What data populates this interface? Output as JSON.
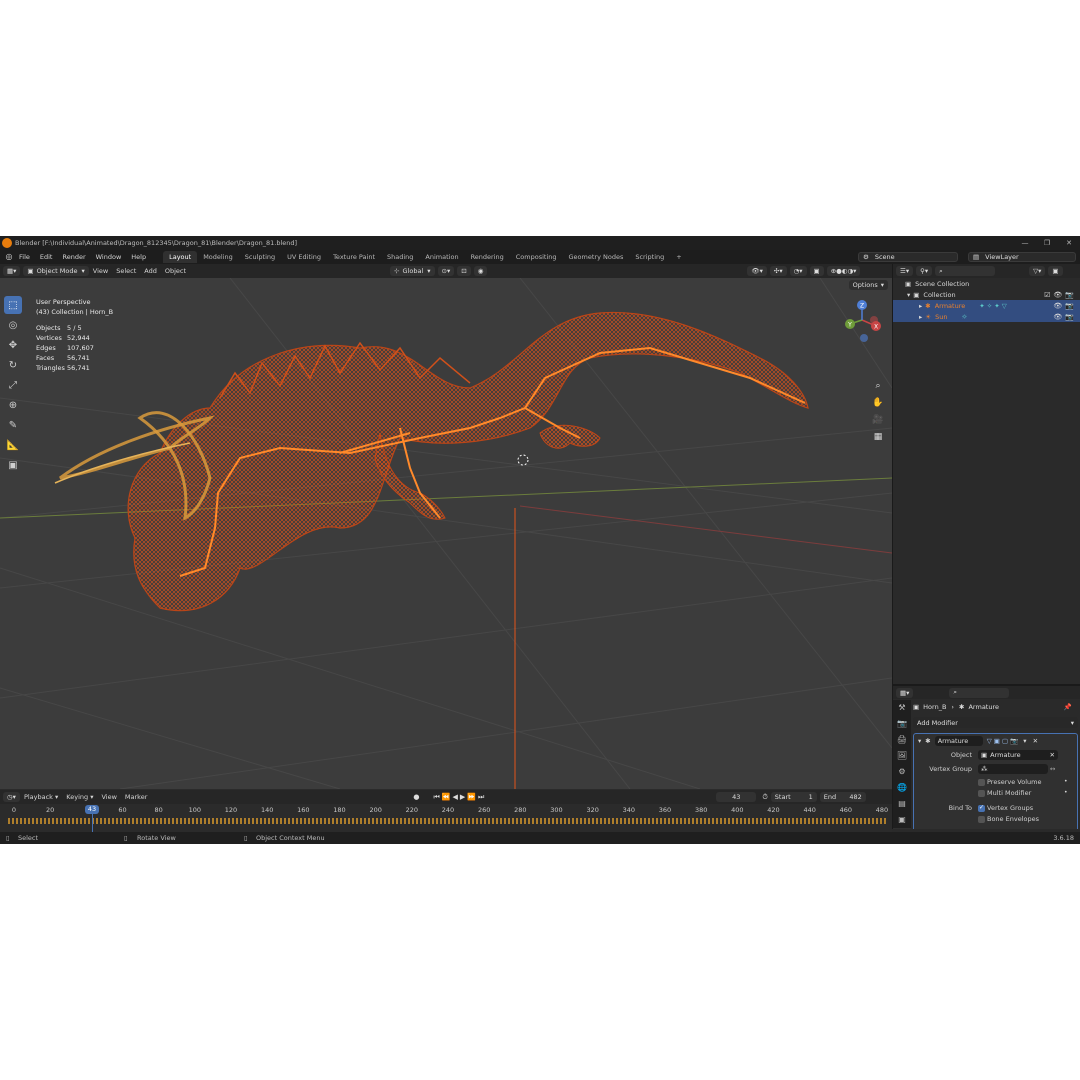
{
  "window": {
    "title": "Blender [F:\\Individual\\Animated\\Dragon_812345\\Dragon_81\\Blender\\Dragon_81.blend]",
    "controls": [
      "—",
      "❐",
      "✕"
    ]
  },
  "menu": [
    "File",
    "Edit",
    "Render",
    "Window",
    "Help"
  ],
  "workspaces": [
    "Layout",
    "Modeling",
    "Sculpting",
    "UV Editing",
    "Texture Paint",
    "Shading",
    "Animation",
    "Rendering",
    "Compositing",
    "Geometry Nodes",
    "Scripting"
  ],
  "active_workspace": "Layout",
  "scene_name": "Scene",
  "view_layer": "ViewLayer",
  "viewport_header": {
    "mode": "Object Mode",
    "menus": [
      "View",
      "Select",
      "Add",
      "Object"
    ],
    "orientation": "Global",
    "options_label": "Options"
  },
  "viewport": {
    "view_name": "User Perspective",
    "collection_line": "(43) Collection | Horn_B",
    "stats": [
      {
        "label": "Objects",
        "value": "5 / 5"
      },
      {
        "label": "Vertices",
        "value": "52,944"
      },
      {
        "label": "Edges",
        "value": "107,607"
      },
      {
        "label": "Faces",
        "value": "56,741"
      },
      {
        "label": "Triangles",
        "value": "56,741"
      }
    ],
    "gizmo_axes": {
      "x": "X",
      "y": "Y",
      "z": "Z"
    },
    "accent_color": "#e2541a"
  },
  "outliner": {
    "root": "Scene Collection",
    "collection": "Collection",
    "items": [
      {
        "name": "Armature",
        "color": "#e8812e"
      },
      {
        "name": "Sun",
        "color": "#e8812e"
      }
    ]
  },
  "properties": {
    "breadcrumb_object": "Horn_B",
    "breadcrumb_modifier": "Armature",
    "add_modifier": "Add Modifier",
    "modifier": {
      "name": "Armature",
      "object_label": "Object",
      "object_value": "Armature",
      "vertex_group_label": "Vertex Group",
      "vertex_group_value": "",
      "preserve_volume": "Preserve Volume",
      "multi_modifier": "Multi Modifier",
      "bind_to_label": "Bind To",
      "vertex_groups": "Vertex Groups",
      "bone_envelopes": "Bone Envelopes"
    }
  },
  "timeline": {
    "menus": [
      "Playback",
      "Keying",
      "View",
      "Marker"
    ],
    "current_frame": "43",
    "start_label": "Start",
    "start": "1",
    "end_label": "End",
    "end": "482",
    "ticks": [
      "0",
      "20",
      "40",
      "60",
      "80",
      "100",
      "120",
      "140",
      "160",
      "180",
      "200",
      "220",
      "240",
      "260",
      "280",
      "300",
      "320",
      "340",
      "360",
      "380",
      "400",
      "420",
      "440",
      "460",
      "480"
    ]
  },
  "statusbar": {
    "select": "Select",
    "rotate": "Rotate View",
    "context": "Object Context Menu",
    "version": "3.6.18"
  }
}
